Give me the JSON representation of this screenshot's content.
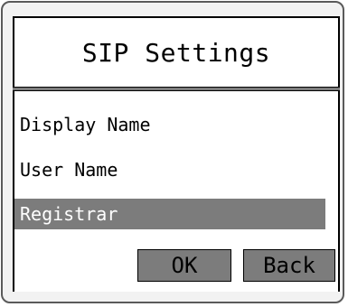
{
  "screen": {
    "title": "SIP Settings",
    "menu": [
      {
        "label": "Display Name",
        "selected": false
      },
      {
        "label": "User Name",
        "selected": false
      },
      {
        "label": "Registrar",
        "selected": true
      }
    ],
    "softkeys": {
      "ok_label": "OK",
      "back_label": "Back"
    }
  },
  "colors": {
    "selection_bg": "#7c7c7c",
    "button_bg": "#7c7c7c",
    "frame": "#5a5a5a",
    "bezel": "#f2f2f2"
  }
}
